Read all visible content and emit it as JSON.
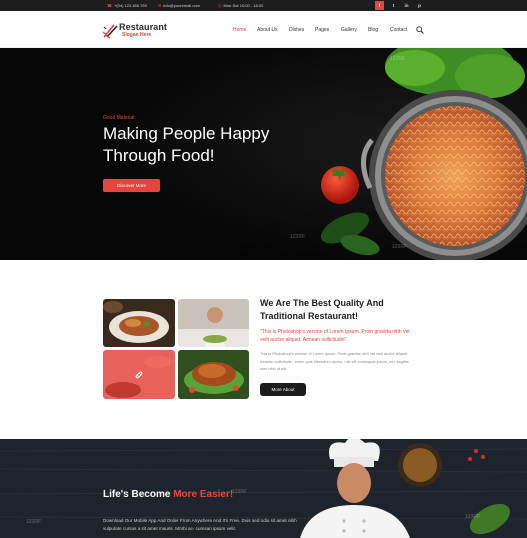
{
  "topbar": {
    "phone": "+(04) 123 456 789",
    "email": "info@youremail.com",
    "hours": "Mon-Sat 10:00 - 18:00",
    "social": [
      "f",
      "t",
      "in",
      "p"
    ]
  },
  "brand": {
    "name": "Restaurant",
    "slogan": "Slogan Here"
  },
  "nav": {
    "items": [
      "Home",
      "About Us",
      "Dishes",
      "Pages",
      "Gallery",
      "Blog",
      "Contact"
    ],
    "active": "Home"
  },
  "hero": {
    "kicker": "Good Material",
    "title": "Making People Happy Through Food!",
    "button": "Discover More",
    "watermark": "123RF"
  },
  "about": {
    "title": "We Are The Best Quality And Traditional Restaurant!",
    "highlight": "\"This is Photoshop's version of Lorem Ipsum. Proin gravida nibh vel velit auctor aliquet. Aenean sollicitudin\"",
    "body": "This is Photoshop's version of Lorem Ipsum. Proin gravida nibh vel velit auctor aliquet. Aenean sollicitudin, lorem quis bibendum auctor, nisi elit consequat ipsum, nec sagittis sem nibh id elit.",
    "button": "More About"
  },
  "app": {
    "title_plain": "Life's Become ",
    "title_accent": "More Easier!",
    "body": "Download Our Mobile App And Order From Anywhere And It's Free. Duis sed odio sit amet nibh vulputate cursus a sit amet mauris. Morbi ac- cumsan ipsum velit."
  },
  "colors": {
    "accent": "#e4463f",
    "dark": "#0b0b0b",
    "topbar": "#1d1d1d"
  },
  "icons": [
    "phone-icon",
    "mail-icon",
    "clock-icon",
    "search-icon",
    "link-icon"
  ]
}
